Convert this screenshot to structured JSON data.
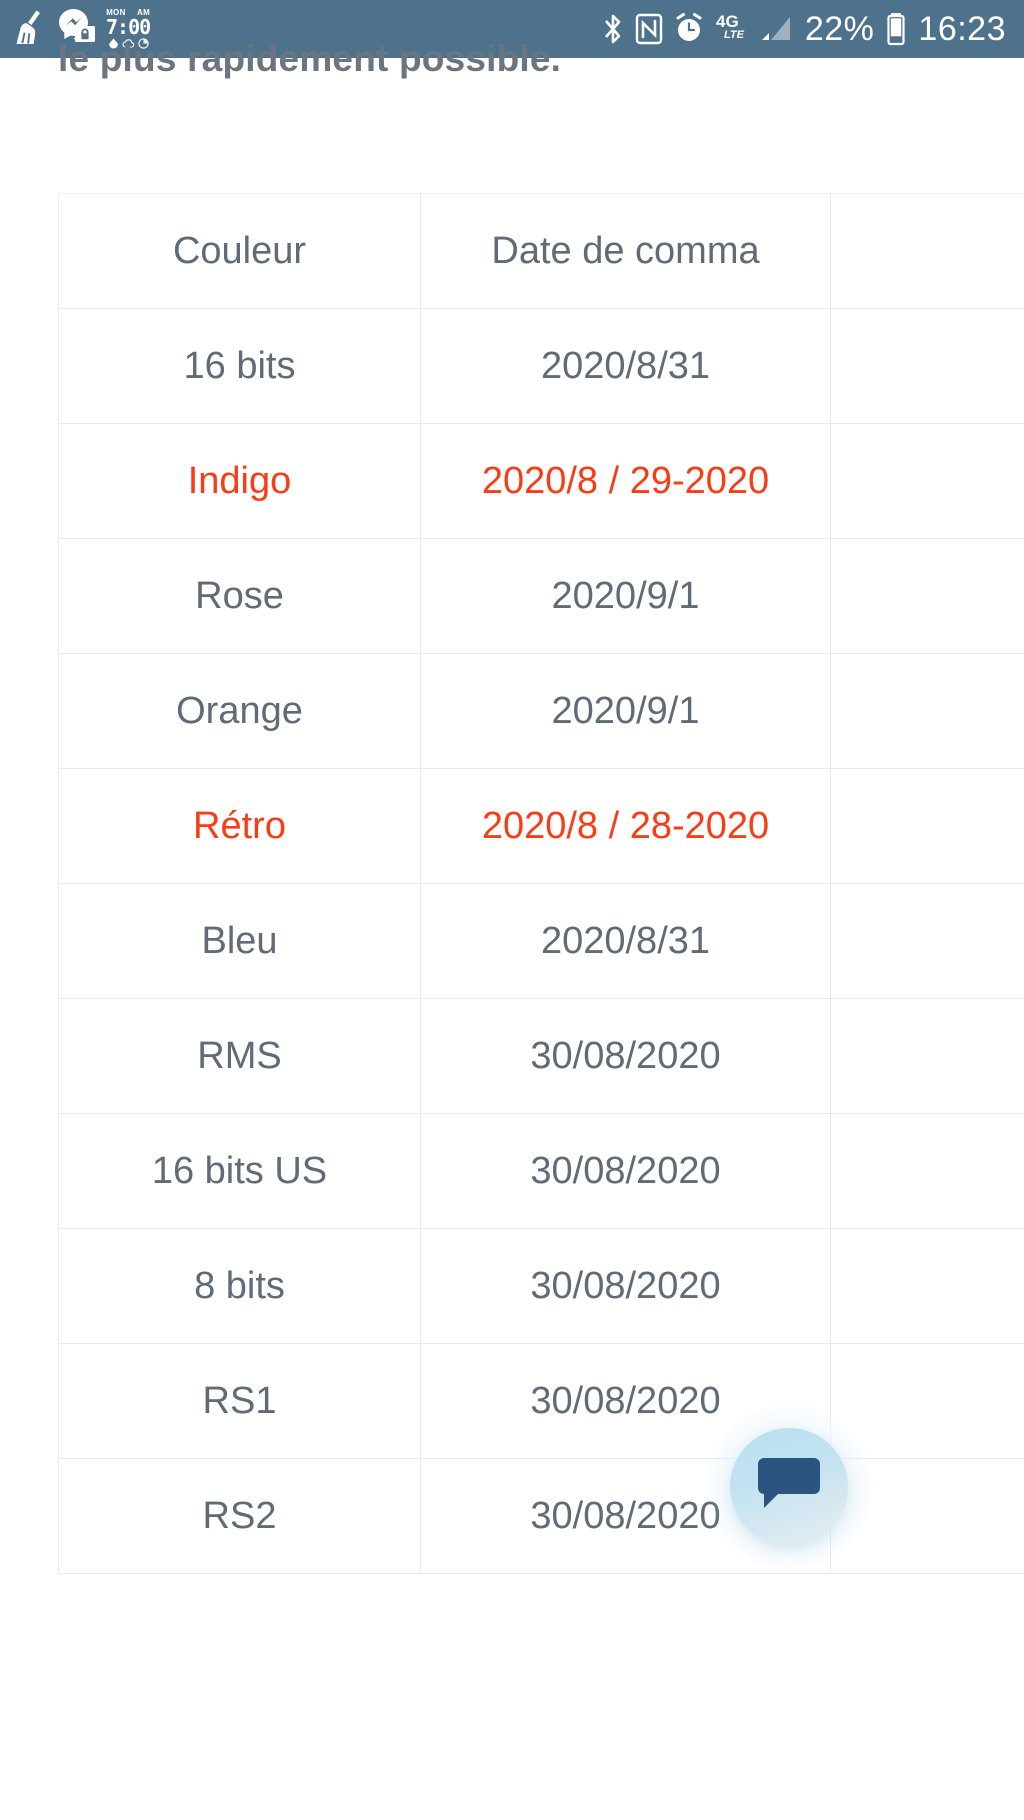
{
  "status_bar": {
    "background_color": "#4e728c",
    "left_icons": [
      {
        "name": "cleaner-broom-icon",
        "glyph": "broom"
      },
      {
        "name": "messenger-lock-icon",
        "glyph": "chat-lock"
      }
    ],
    "clock_widget": {
      "day": "MON",
      "meridiem": "AM",
      "time": "7:00"
    },
    "right_icons": [
      {
        "name": "bluetooth-icon",
        "glyph": "bluetooth"
      },
      {
        "name": "nfc-icon",
        "glyph": "nfc"
      },
      {
        "name": "alarm-clock-icon",
        "glyph": "alarm"
      },
      {
        "name": "network-4g-lte-icon",
        "label_top": "4G",
        "label_bottom": "LTE"
      },
      {
        "name": "signal-bars-icon",
        "glyph": "signal"
      }
    ],
    "battery_percent": "22%",
    "time": "16:23"
  },
  "content": {
    "clipped_heading": "le plus rapidement possible."
  },
  "table": {
    "columns": [
      "Couleur",
      "Date de comma",
      ""
    ],
    "rows": [
      {
        "color": "16 bits",
        "date": "2020/8/31",
        "extra": "",
        "alert": false
      },
      {
        "color": "Indigo",
        "date": "2020/8 / 29-2020",
        "extra": "",
        "alert": true
      },
      {
        "color": "Rose",
        "date": "2020/9/1",
        "extra": "",
        "alert": false
      },
      {
        "color": "Orange",
        "date": "2020/9/1",
        "extra": "",
        "alert": false
      },
      {
        "color": "Rétro",
        "date": "2020/8 / 28-2020",
        "extra": "",
        "alert": true
      },
      {
        "color": "Bleu",
        "date": "2020/8/31",
        "extra": "",
        "alert": false
      },
      {
        "color": "RMS",
        "date": "30/08/2020",
        "extra": "",
        "alert": false
      },
      {
        "color": "16 bits US",
        "date": "30/08/2020",
        "extra": "",
        "alert": false
      },
      {
        "color": "8 bits",
        "date": "30/08/2020",
        "extra": "",
        "alert": false
      },
      {
        "color": "RS1",
        "date": "30/08/2020",
        "extra": "",
        "alert": false
      },
      {
        "color": "RS2",
        "date": "30/08/2020",
        "extra": "",
        "alert": false
      }
    ],
    "alert_color": "#fa3c14",
    "text_color": "#5f6b77",
    "border_color": "#e9ecef"
  },
  "chat_widget": {
    "name": "chat-support-button",
    "bubble_color": "#2c5480",
    "halo_color": "#b9e0f3"
  }
}
